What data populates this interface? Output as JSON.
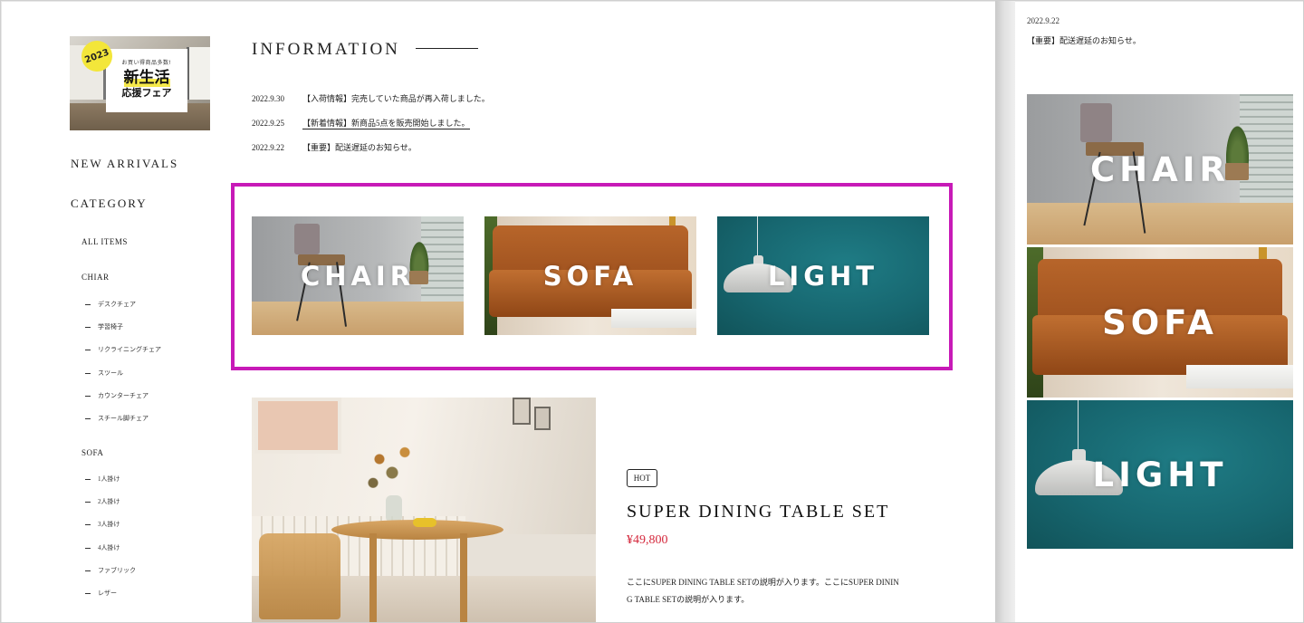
{
  "banner": {
    "year": "2023",
    "sub": "お買い得商品多数!",
    "title_line1": "新生活",
    "title_line2": "応援フェア"
  },
  "sidebar": {
    "new_arrivals": "NEW ARRIVALS",
    "category": "CATEGORY",
    "all_items": "ALL ITEMS",
    "chair_head": "CHIAR",
    "chair_items": [
      "デスクチェア",
      "学習椅子",
      "リクライニングチェア",
      "スツール",
      "カウンターチェア",
      "スチール脚チェア"
    ],
    "sofa_head": "SOFA",
    "sofa_items": [
      "1人掛け",
      "2人掛け",
      "3人掛け",
      "4人掛け",
      "ファブリック",
      "レザー"
    ]
  },
  "information": {
    "title": "INFORMATION",
    "news": [
      {
        "date": "2022.9.30",
        "text": "【入荷情報】完売していた商品が再入荷しました。"
      },
      {
        "date": "2022.9.25",
        "text": "【新着情報】新商品5点を販売開始しました。"
      },
      {
        "date": "2022.9.22",
        "text": "【重要】配送遅延のお知らせ。"
      }
    ]
  },
  "categories": {
    "chair": "CHAIR",
    "sofa": "SOFA",
    "light": "LIGHT"
  },
  "product": {
    "badge": "HOT",
    "title": "SUPER DINING TABLE SET",
    "price": "¥49,800",
    "description": "ここにSUPER DINING TABLE SETの説明が入ります。ここにSUPER DINING TABLE SETの説明が入ります。"
  },
  "mobile": {
    "date": "2022.9.22",
    "news_text": "【重要】配送遅延のお知らせ。",
    "chair": "CHAIR",
    "sofa": "SOFA",
    "light": "LIGHT"
  },
  "colors": {
    "highlight": "#c71ab7",
    "price": "#d4283c",
    "light_tile": "#176770",
    "sofa_leather": "#b7652a"
  }
}
